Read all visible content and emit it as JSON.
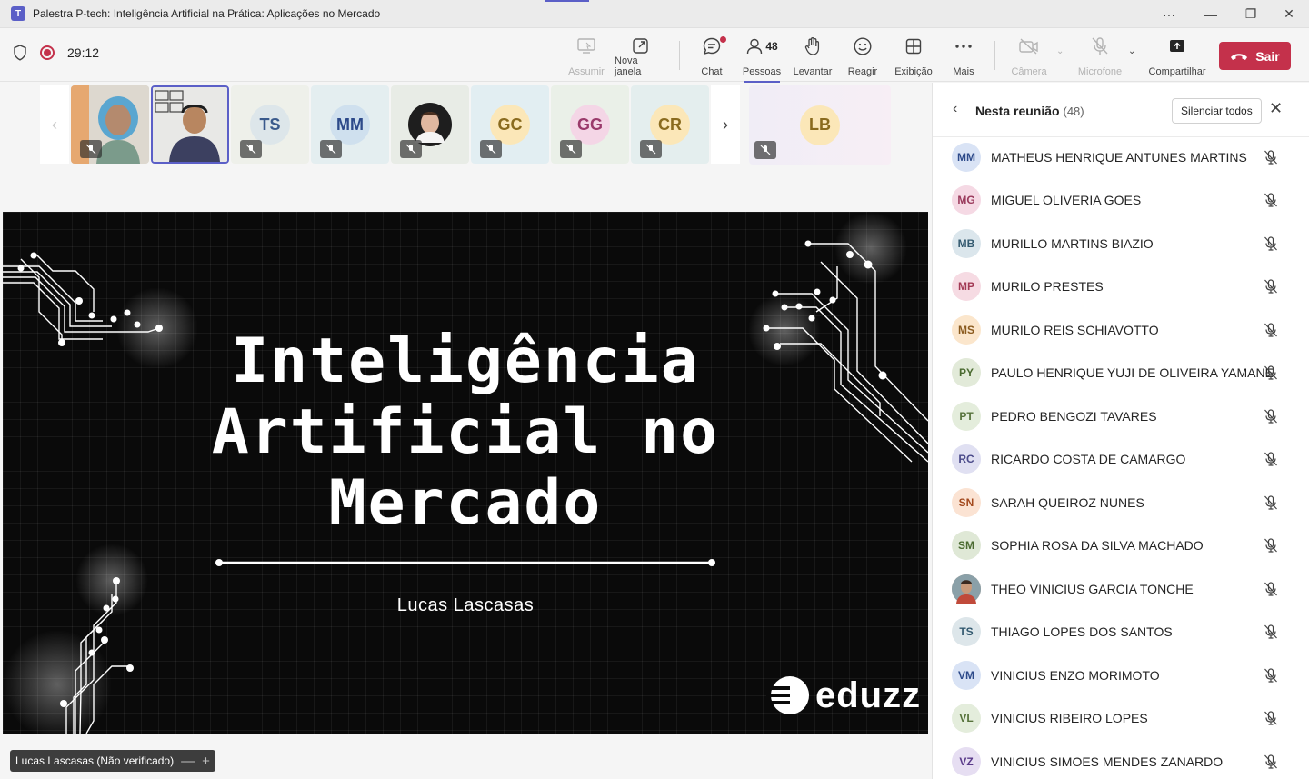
{
  "window": {
    "title": "Palestra P-tech: Inteligência Artificial na Prática: Aplicações no Mercado",
    "controls": {
      "more": "···",
      "minimize": "—",
      "restore": "❐",
      "close": "✕"
    }
  },
  "toolbar": {
    "timer": "29:12",
    "buttons": {
      "assumir": "Assumir",
      "nova_janela": "Nova janela",
      "chat": "Chat",
      "pessoas": "Pessoas",
      "pessoas_count": "48",
      "levantar": "Levantar",
      "reagir": "Reagir",
      "exibicao": "Exibição",
      "mais": "Mais",
      "camera": "Câmera",
      "microfone": "Microfone",
      "compartilhar": "Compartilhar",
      "sair": "Sair"
    }
  },
  "strip": {
    "tiles": [
      {
        "type": "video",
        "name": "participant-video-1"
      },
      {
        "type": "video",
        "name": "participant-video-2"
      },
      {
        "initials": "TS",
        "color": "#3a5a8c",
        "avatar_bg": "#dde6ea"
      },
      {
        "initials": "MM",
        "color": "#2d4a8a",
        "avatar_bg": "#cfe0ee"
      },
      {
        "type": "video",
        "name": "participant-video-3"
      },
      {
        "initials": "GC",
        "color": "#8a6b1e",
        "avatar_bg": "#fbe7b8"
      },
      {
        "initials": "GG",
        "color": "#9a3a6b",
        "avatar_bg": "#f4d6e6"
      },
      {
        "initials": "CR",
        "color": "#8a6b1e",
        "avatar_bg": "#fbe7b8"
      }
    ],
    "lb": {
      "initials": "LB",
      "color": "#8a6b1e",
      "avatar_bg": "#fbe7b8"
    }
  },
  "slide": {
    "title_lines": [
      "Inteligência",
      "Artificial no",
      "Mercado"
    ],
    "author": "Lucas Lascasas",
    "brand": "eduzz"
  },
  "name_tag": {
    "label": "Lucas Lascasas (Não verificado)",
    "minus": "—",
    "plus": "+"
  },
  "panel": {
    "title": "Nesta reunião",
    "count": "(48)",
    "mute_all": "Silenciar todos",
    "participants": [
      {
        "initials": "MM",
        "name": "MATHEUS HENRIQUE ANTUNES MARTINS",
        "bg": "#d9e3f5",
        "fg": "#2d4a8a"
      },
      {
        "initials": "MG",
        "name": "MIGUEL OLIVERIA GOES",
        "bg": "#f5d9e4",
        "fg": "#9a3a5c"
      },
      {
        "initials": "MB",
        "name": "MURILLO MARTINS BIAZIO",
        "bg": "#dbe6ec",
        "fg": "#345a70"
      },
      {
        "initials": "MP",
        "name": "MURILO PRESTES",
        "bg": "#f6dbe3",
        "fg": "#a33a55"
      },
      {
        "initials": "MS",
        "name": "MURILO REIS SCHIAVOTTO",
        "bg": "#fbe6cc",
        "fg": "#8a5a1e"
      },
      {
        "initials": "PY",
        "name": "PAULO HENRIQUE YUJI DE OLIVEIRA YAMANE",
        "bg": "#e2ead9",
        "fg": "#4a6a30"
      },
      {
        "initials": "PT",
        "name": "PEDRO BENGOZI TAVARES",
        "bg": "#e4eddc",
        "fg": "#56723a"
      },
      {
        "initials": "RC",
        "name": "RICARDO COSTA DE CAMARGO",
        "bg": "#e0e0f2",
        "fg": "#4a4a8a"
      },
      {
        "initials": "SN",
        "name": "SARAH QUEIROZ NUNES",
        "bg": "#fbe3d3",
        "fg": "#a34a1e"
      },
      {
        "initials": "SM",
        "name": "SOPHIA ROSA DA SILVA MACHADO",
        "bg": "#dfe8d6",
        "fg": "#4a6a30"
      },
      {
        "initials": "",
        "name": "THEO VINICIUS GARCIA TONCHE",
        "bg": "#c7a48c",
        "fg": "#ffffff",
        "photo": true
      },
      {
        "initials": "TS",
        "name": "THIAGO LOPES DOS SANTOS",
        "bg": "#dde6ea",
        "fg": "#345a70"
      },
      {
        "initials": "VM",
        "name": "VINICIUS ENZO MORIMOTO",
        "bg": "#d9e3f5",
        "fg": "#2d4a8a"
      },
      {
        "initials": "VL",
        "name": "VINICIUS RIBEIRO LOPES",
        "bg": "#e4eddc",
        "fg": "#56723a"
      },
      {
        "initials": "VZ",
        "name": "VINICIUS SIMOES MENDES ZANARDO",
        "bg": "#e6def2",
        "fg": "#5a3a8a"
      }
    ]
  }
}
